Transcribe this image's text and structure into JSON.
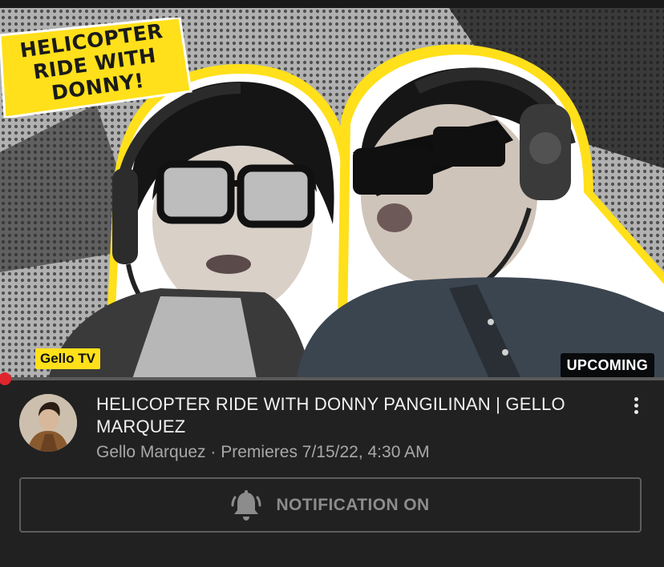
{
  "thumbnail": {
    "sticker_lines": [
      "HELICOPTER",
      "RIDE WITH",
      "DONNY!"
    ],
    "logo": "Gello TV",
    "badge": "UPCOMING",
    "accent_color": "#ffe01a"
  },
  "video": {
    "title": "HELICOPTER RIDE WITH DONNY PANGILINAN | GELLO MARQUEZ",
    "channel": "Gello Marquez",
    "separator": "·",
    "premiere": "Premieres 7/15/22, 4:30 AM",
    "more_icon": "more-vert-icon"
  },
  "notification": {
    "label": "NOTIFICATION ON",
    "icon": "bell-ringing-icon"
  },
  "progress": {
    "fraction": 0.0,
    "color": "#e0242d"
  }
}
